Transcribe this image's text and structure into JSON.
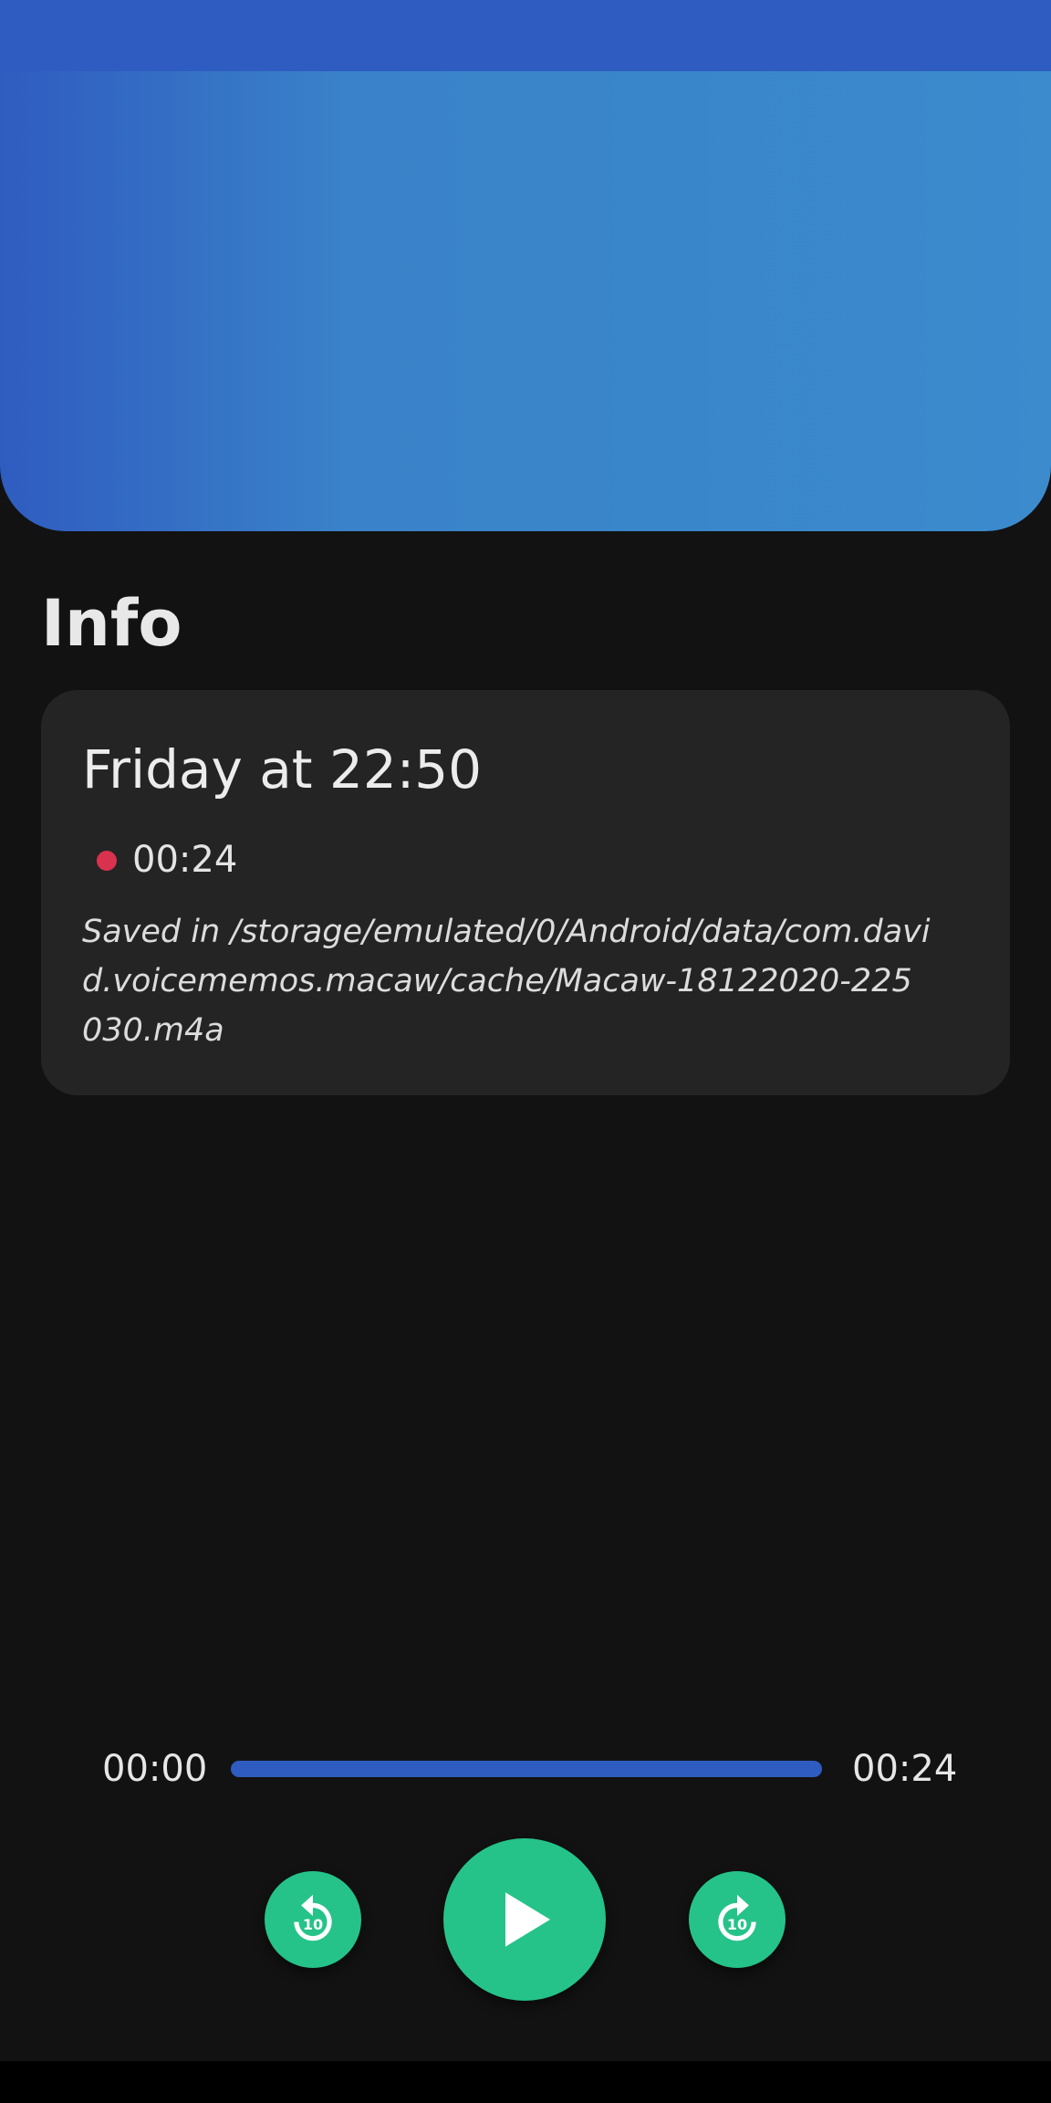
{
  "section": {
    "title": "Info"
  },
  "recording": {
    "title": "Friday at 22:50",
    "duration": "00:24",
    "saved_path": "Saved in /storage/emulated/0/Android/data/com.david.voicememos.macaw/cache/Macaw-18122020-225030.m4a"
  },
  "player": {
    "current_time": "00:00",
    "total_time": "00:24",
    "progress": 0,
    "rewind_icon": "replay-10-icon",
    "play_icon": "play-icon",
    "forward_icon": "forward-10-icon",
    "skip_label": "10"
  },
  "colors": {
    "accent_blue": "#2f5cc0",
    "gradient_blue": "#3b8bcd",
    "button_green": "#25c389",
    "record_dot": "#d9324e",
    "background": "#121212",
    "card": "#242424"
  }
}
